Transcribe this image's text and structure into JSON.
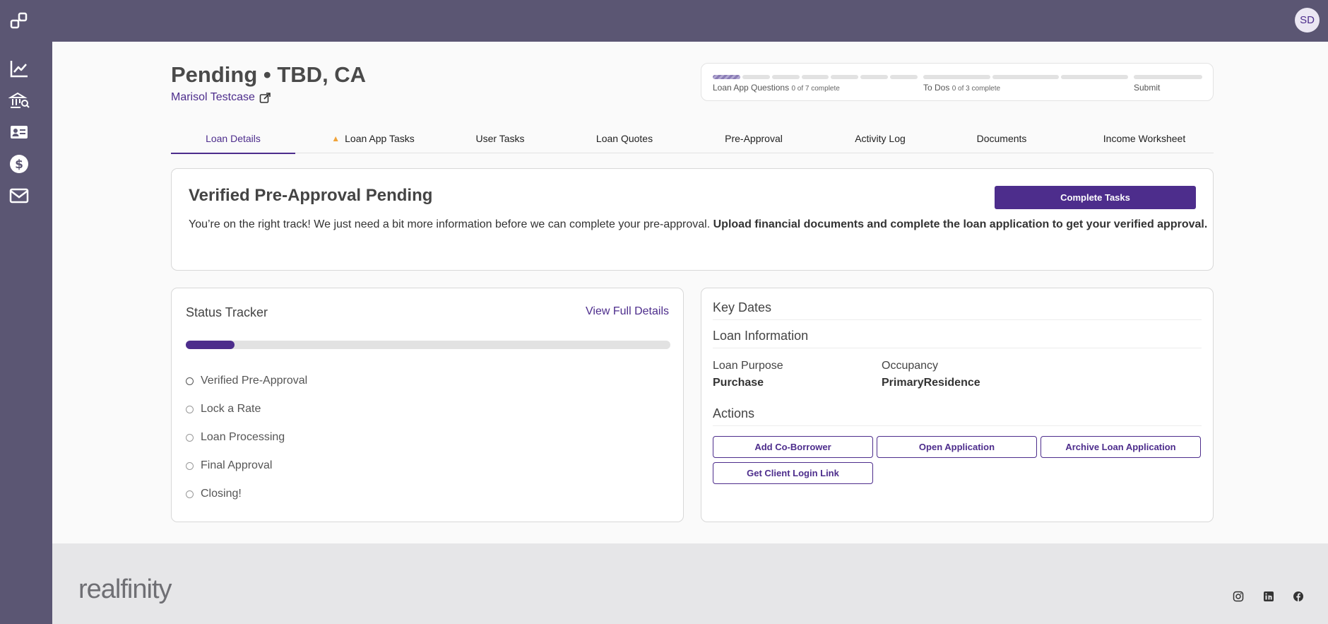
{
  "user": {
    "initials": "SD"
  },
  "page": {
    "title": "Pending • TBD, CA",
    "borrower": "Marisol Testcase"
  },
  "progress": {
    "groups": [
      {
        "label": "Loan App Questions",
        "sub": "0 of 7 complete",
        "segments": 7,
        "active_segments": 1
      },
      {
        "label": "To Dos",
        "sub": "0 of 3 complete",
        "segments": 3,
        "active_segments": 0
      },
      {
        "label": "Submit",
        "sub": "",
        "segments": 1,
        "active_segments": 0
      }
    ]
  },
  "tabs": [
    {
      "label": "Loan Details",
      "active": true
    },
    {
      "label": "Loan App Tasks",
      "warning": true
    },
    {
      "label": "User Tasks"
    },
    {
      "label": "Loan Quotes"
    },
    {
      "label": "Pre-Approval"
    },
    {
      "label": "Activity Log"
    },
    {
      "label": "Documents"
    },
    {
      "label": "Income Worksheet"
    }
  ],
  "banner": {
    "title": "Verified Pre-Approval Pending",
    "text": "You’re on the right track! We just need a bit more information before we can complete your pre-approval.",
    "text_bold": "Upload financial documents and complete the loan application to get your verified approval.",
    "button": "Complete Tasks"
  },
  "status_tracker": {
    "title": "Status Tracker",
    "link": "View Full Details",
    "progress": 0.1,
    "steps": [
      "Verified Pre-Approval",
      "Lock a Rate",
      "Loan Processing",
      "Final Approval",
      "Closing!"
    ]
  },
  "key_dates": {
    "title": "Key Dates",
    "loan_info_title": "Loan Information",
    "loan_purpose_label": "Loan Purpose",
    "loan_purpose_value": "Purchase",
    "occupancy_label": "Occupancy",
    "occupancy_value": "PrimaryResidence",
    "actions_title": "Actions",
    "actions": [
      "Add Co-Borrower",
      "Open Application",
      "Archive Loan Application",
      "Get Client Login Link"
    ]
  },
  "footer": {
    "brand": "realfinity"
  },
  "icons": {
    "sidebar": [
      "chart-line-icon",
      "bank-search-icon",
      "contact-card-icon",
      "dollar-icon",
      "mail-icon"
    ],
    "social": [
      "instagram-icon",
      "linkedin-icon",
      "facebook-icon"
    ]
  },
  "colors": {
    "sidebar": "#5b5673",
    "accent": "#4d2d8c",
    "warning": "#f0a43b",
    "footer": "#e6e6e8"
  }
}
